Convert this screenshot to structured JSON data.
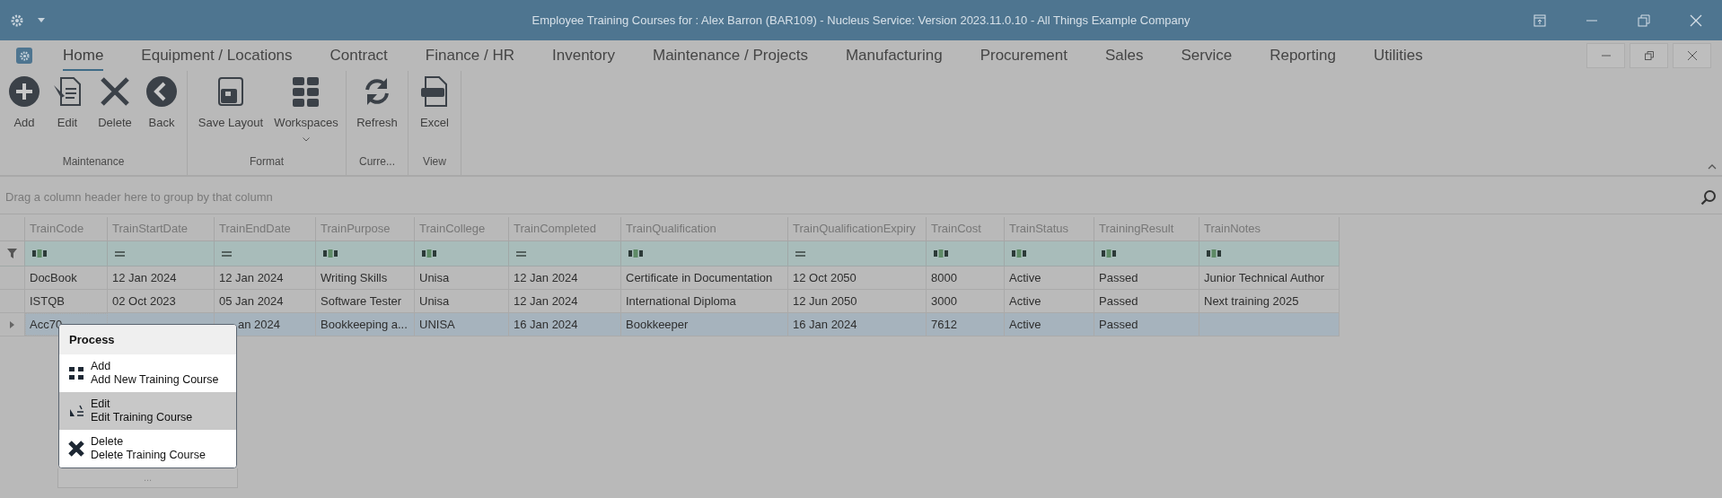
{
  "window": {
    "title": "Employee Training Courses for : Alex Barron (BAR109) - Nucleus Service: Version 2023.11.0.10 - All Things Example Company"
  },
  "menu_tabs": [
    {
      "label": "Home",
      "selected": true
    },
    {
      "label": "Equipment / Locations",
      "selected": false
    },
    {
      "label": "Contract",
      "selected": false
    },
    {
      "label": "Finance / HR",
      "selected": false
    },
    {
      "label": "Inventory",
      "selected": false
    },
    {
      "label": "Maintenance / Projects",
      "selected": false
    },
    {
      "label": "Manufacturing",
      "selected": false
    },
    {
      "label": "Procurement",
      "selected": false
    },
    {
      "label": "Sales",
      "selected": false
    },
    {
      "label": "Service",
      "selected": false
    },
    {
      "label": "Reporting",
      "selected": false
    },
    {
      "label": "Utilities",
      "selected": false
    }
  ],
  "ribbon_groups": [
    {
      "label": "Maintenance",
      "buttons": [
        {
          "label": "Add",
          "kind": "add"
        },
        {
          "label": "Edit",
          "kind": "edit"
        },
        {
          "label": "Delete",
          "kind": "delete"
        },
        {
          "label": "Back",
          "kind": "back"
        }
      ]
    },
    {
      "label": "Format",
      "buttons": [
        {
          "label": "Save Layout",
          "kind": "save"
        },
        {
          "label": "Workspaces",
          "kind": "grid",
          "dropdown": true
        }
      ]
    },
    {
      "label": "Curre...",
      "buttons": [
        {
          "label": "Refresh",
          "kind": "refresh"
        }
      ]
    },
    {
      "label": "View",
      "buttons": [
        {
          "label": "Excel",
          "kind": "excel"
        }
      ]
    }
  ],
  "group_panel": {
    "hint": "Drag a column header here to group by that column"
  },
  "grid": {
    "columns": [
      {
        "label": "TrainCode",
        "kind": "text"
      },
      {
        "label": "TrainStartDate",
        "kind": "equals"
      },
      {
        "label": "TrainEndDate",
        "kind": "equals"
      },
      {
        "label": "TrainPurpose",
        "kind": "text"
      },
      {
        "label": "TrainCollege",
        "kind": "text"
      },
      {
        "label": "TrainCompleted",
        "kind": "equals"
      },
      {
        "label": "TrainQualification",
        "kind": "text"
      },
      {
        "label": "TrainQualificationExpiry",
        "kind": "equals"
      },
      {
        "label": "TrainCost",
        "kind": "text"
      },
      {
        "label": "TrainStatus",
        "kind": "text"
      },
      {
        "label": "TrainingResult",
        "kind": "text"
      },
      {
        "label": "TrainNotes",
        "kind": "text"
      }
    ],
    "rows": [
      {
        "current": false,
        "cells": [
          "DocBook",
          "12 Jan 2024",
          "12 Jan 2024",
          "Writing Skills",
          "Unisa",
          "12 Jan 2024",
          "Certificate in Documentation",
          "12 Oct 2050",
          "8000",
          "Active",
          "Passed",
          "Junior Technical Author"
        ]
      },
      {
        "current": false,
        "cells": [
          "ISTQB",
          "02 Oct 2023",
          "05 Jan 2024",
          "Software Tester",
          "Unisa",
          "12 Jan 2024",
          "International Diploma",
          "12 Jun 2050",
          "3000",
          "Active",
          "Passed",
          "Next training 2025"
        ]
      },
      {
        "current": true,
        "cells": [
          "Acc70",
          null,
          "an 2024",
          "Bookkeeping a...",
          "UNISA",
          "16 Jan 2024",
          "Bookkeeper",
          "16 Jan 2024",
          "7612",
          "Active",
          "Passed",
          null
        ]
      }
    ]
  },
  "context_menu": {
    "title": "Process",
    "items": [
      {
        "label": "Add",
        "description": "Add New Training Course",
        "kind": "add",
        "selected": false
      },
      {
        "label": "Edit",
        "description": "Edit Training Course",
        "kind": "edit",
        "selected": true
      },
      {
        "label": "Delete",
        "description": "Delete Training Course",
        "kind": "delete",
        "selected": false
      }
    ],
    "more": "..."
  }
}
